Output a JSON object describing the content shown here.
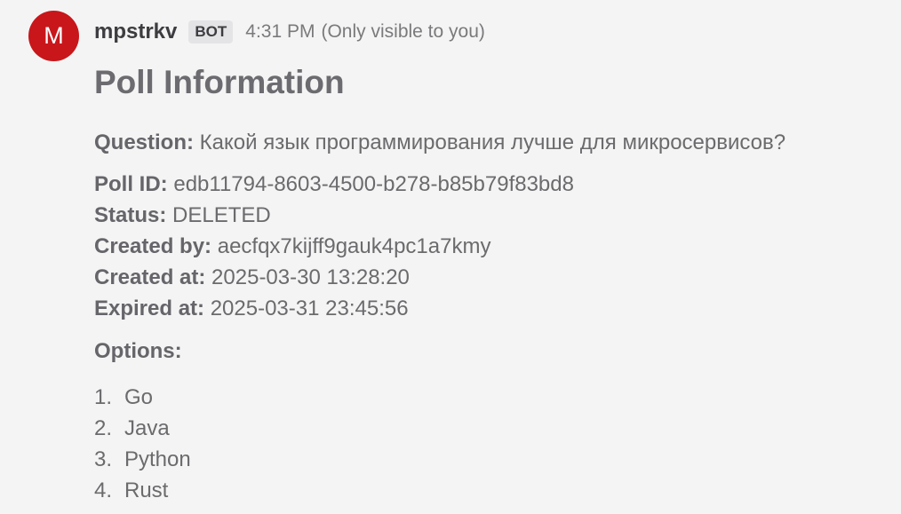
{
  "post": {
    "avatar_letter": "M",
    "username": "mpstrkv",
    "badge": "BOT",
    "time": "4:31 PM",
    "visibility": "(Only visible to you)"
  },
  "poll": {
    "title": "Poll Information",
    "question_label": "Question:",
    "question": "Какой язык программирования лучше для микросервисов?",
    "fields": [
      {
        "label": "Poll ID:",
        "value": "edb11794-8603-4500-b278-b85b79f83bd8"
      },
      {
        "label": "Status:",
        "value": "DELETED"
      },
      {
        "label": "Created by:",
        "value": "aecfqx7kijff9gauk4pc1a7kmy"
      },
      {
        "label": "Created at:",
        "value": "2025-03-30 13:28:20"
      },
      {
        "label": "Expired at:",
        "value": "2025-03-31 23:45:56"
      }
    ],
    "options_label": "Options:",
    "options": [
      {
        "num": "1.",
        "text": "Go"
      },
      {
        "num": "2.",
        "text": "Java"
      },
      {
        "num": "3.",
        "text": "Python"
      },
      {
        "num": "4.",
        "text": "Rust"
      }
    ]
  },
  "colors": {
    "avatar_bg": "#c8161b",
    "background": "#f4f4f4",
    "text": "#6b6b6e",
    "username": "#3d3c40"
  }
}
